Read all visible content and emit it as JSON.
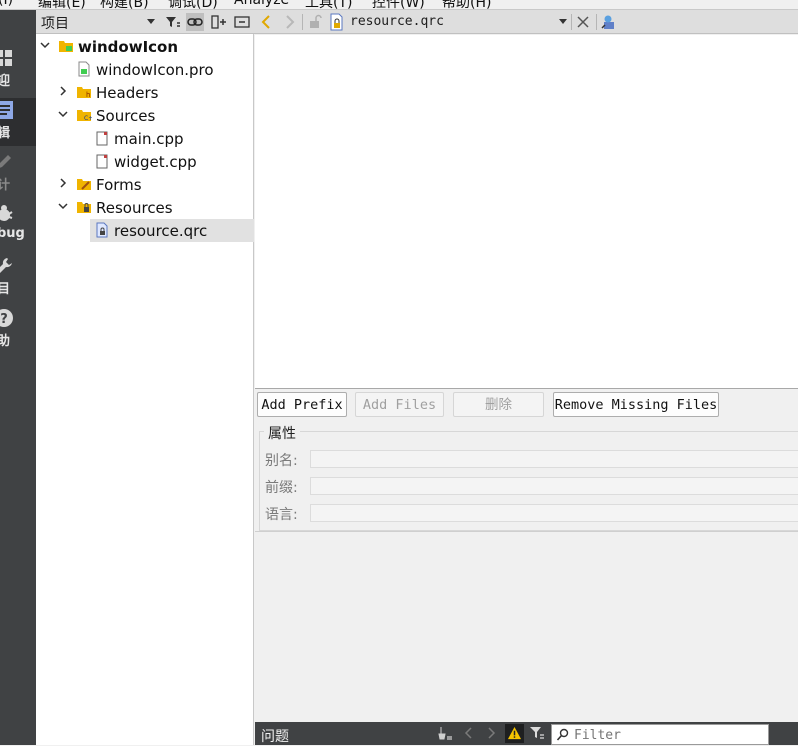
{
  "menu": {
    "items": [
      "(I)",
      "编辑(E)",
      "构建(B)",
      "调试(D)",
      "Analyze",
      "工具(T)",
      "控件(W)",
      "帮助(H)"
    ]
  },
  "modes": [
    {
      "label": "迎",
      "icon": "grid-icon"
    },
    {
      "label": "辑",
      "icon": "document-icon",
      "active": true
    },
    {
      "label": "计",
      "icon": "pencil-icon",
      "disabled": true
    },
    {
      "label": "bug",
      "icon": "bug-icon"
    },
    {
      "label": "目",
      "icon": "wrench-icon"
    },
    {
      "label": "助",
      "icon": "help-icon"
    }
  ],
  "project_panel": {
    "title": "项目"
  },
  "tree": [
    {
      "label": "windowIcon",
      "bold": true
    },
    {
      "label": "windowIcon.pro"
    },
    {
      "label": "Headers"
    },
    {
      "label": "Sources"
    },
    {
      "label": "main.cpp"
    },
    {
      "label": "widget.cpp"
    },
    {
      "label": "Forms"
    },
    {
      "label": "Resources"
    },
    {
      "label": "resource.qrc",
      "selected": true
    }
  ],
  "editor": {
    "filename": "resource.qrc"
  },
  "buttons": {
    "add_prefix": "Add Prefix",
    "add_files": "Add Files",
    "remove": "删除",
    "remove_missing": "Remove Missing Files"
  },
  "properties": {
    "group_title": "属性",
    "alias_label": "别名:",
    "prefix_label": "前缀:",
    "language_label": "语言:"
  },
  "statusbar": {
    "issues_label": "问题",
    "filter_placeholder": "Filter"
  },
  "colors": {
    "sidebar_bg": "#404244",
    "accent_folder": "#f0b400",
    "warning": "#f5c400"
  }
}
